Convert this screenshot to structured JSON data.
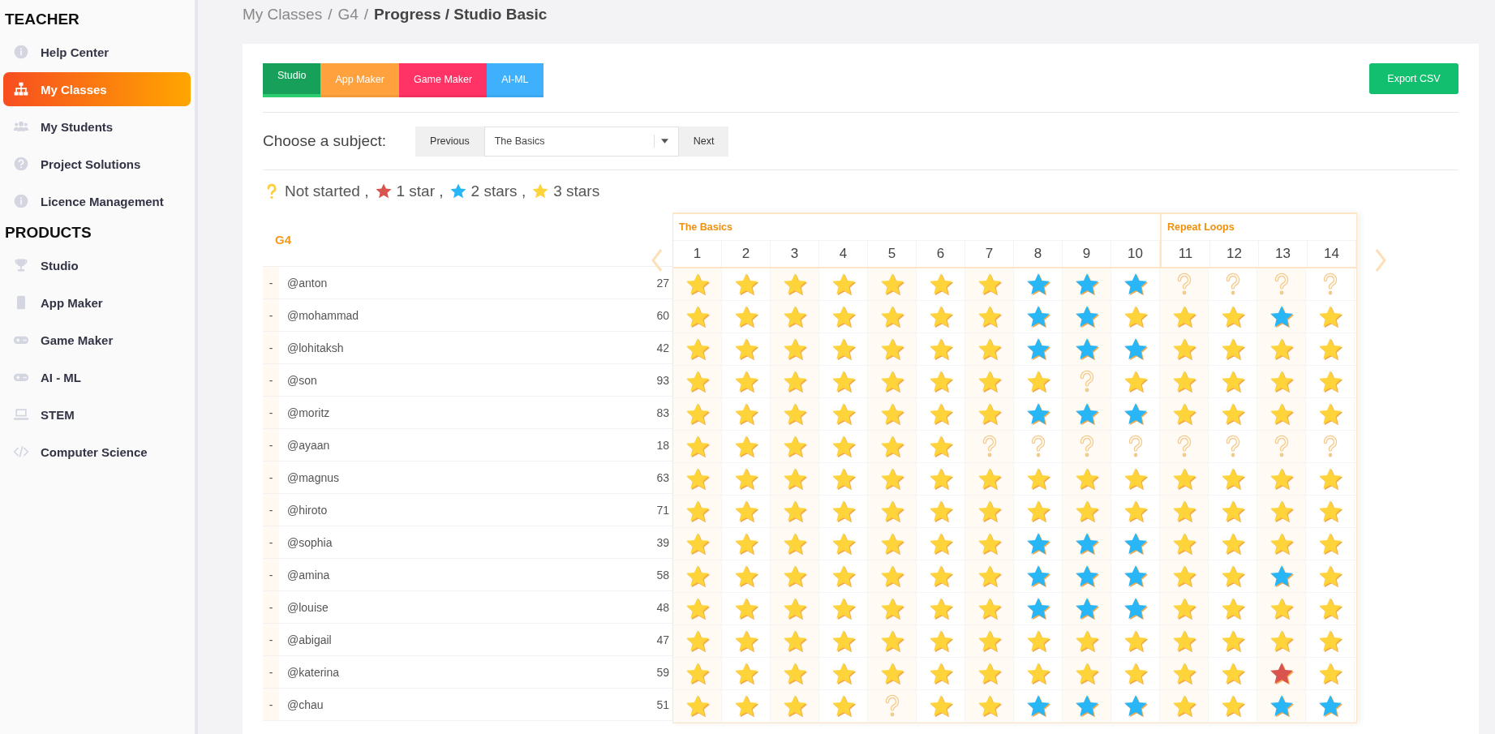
{
  "sidebar": {
    "sections": [
      {
        "heading": "TEACHER",
        "items": [
          {
            "label": "Help Center",
            "selected": false
          },
          {
            "label": "My Classes",
            "selected": true
          },
          {
            "label": "My Students",
            "selected": false
          },
          {
            "label": "Project Solutions",
            "selected": false
          },
          {
            "label": "Licence Management",
            "selected": false
          }
        ]
      },
      {
        "heading": "PRODUCTS",
        "items": [
          {
            "label": "Studio",
            "selected": false
          },
          {
            "label": "App Maker",
            "selected": false
          },
          {
            "label": "Game Maker",
            "selected": false
          },
          {
            "label": "AI - ML",
            "selected": false
          },
          {
            "label": "STEM",
            "selected": false
          },
          {
            "label": "Computer Science",
            "selected": false
          }
        ]
      }
    ]
  },
  "breadcrumb": [
    {
      "kind": "link",
      "text": "My Classes"
    },
    {
      "kind": "sep",
      "text": "/"
    },
    {
      "kind": "link",
      "text": "G4"
    },
    {
      "kind": "sep",
      "text": "/"
    },
    {
      "kind": "current",
      "text": "Progress / Studio Basic"
    }
  ],
  "product_tabs": [
    {
      "label": "Studio",
      "color": "#17a05a",
      "selected": true
    },
    {
      "label": "App Maker",
      "color": "#ffa23e",
      "selected": false
    },
    {
      "label": "Game Maker",
      "color": "#ff3366",
      "selected": false
    },
    {
      "label": "AI-ML",
      "color": "#3fb1fc",
      "selected": false
    }
  ],
  "export_button": "Export CSV",
  "subject": {
    "label": "Choose a subject:",
    "previous": "Previous",
    "value": "The Basics",
    "next": "Next"
  },
  "legend": [
    {
      "kind": "none",
      "label": "Not started ,"
    },
    {
      "kind": "one",
      "label": "1 star ,"
    },
    {
      "kind": "two",
      "label": "2 stars ,"
    },
    {
      "kind": "three",
      "label": "3 stars"
    }
  ],
  "progress_table": {
    "class_name": "G4",
    "sections": [
      {
        "title": "The Basics",
        "columns": [
          "1",
          "2",
          "3",
          "4",
          "5",
          "6",
          "7",
          "8",
          "9",
          "10"
        ]
      },
      {
        "title": "Repeat Loops",
        "columns": [
          "11",
          "12",
          "13",
          "14"
        ]
      }
    ],
    "students": [
      {
        "marker": "-",
        "name": "@anton",
        "score": "27",
        "cells": [
          {
            "kind": "three"
          },
          {
            "kind": "three"
          },
          {
            "kind": "three"
          },
          {
            "kind": "three"
          },
          {
            "kind": "three"
          },
          {
            "kind": "three"
          },
          {
            "kind": "three"
          },
          {
            "kind": "two"
          },
          {
            "kind": "two"
          },
          {
            "kind": "two"
          },
          {
            "kind": "none"
          },
          {
            "kind": "none"
          },
          {
            "kind": "none"
          },
          {
            "kind": "none"
          }
        ]
      },
      {
        "marker": "-",
        "name": "@mohammad",
        "score": "60",
        "cells": [
          {
            "kind": "three"
          },
          {
            "kind": "three"
          },
          {
            "kind": "three"
          },
          {
            "kind": "three"
          },
          {
            "kind": "three"
          },
          {
            "kind": "three"
          },
          {
            "kind": "three"
          },
          {
            "kind": "two"
          },
          {
            "kind": "two"
          },
          {
            "kind": "three"
          },
          {
            "kind": "three"
          },
          {
            "kind": "three"
          },
          {
            "kind": "two"
          },
          {
            "kind": "three"
          }
        ]
      },
      {
        "marker": "-",
        "name": "@lohitaksh",
        "score": "42",
        "cells": [
          {
            "kind": "three"
          },
          {
            "kind": "three"
          },
          {
            "kind": "three"
          },
          {
            "kind": "three"
          },
          {
            "kind": "three"
          },
          {
            "kind": "three"
          },
          {
            "kind": "three"
          },
          {
            "kind": "two"
          },
          {
            "kind": "two"
          },
          {
            "kind": "two"
          },
          {
            "kind": "three"
          },
          {
            "kind": "three"
          },
          {
            "kind": "three"
          },
          {
            "kind": "three"
          }
        ]
      },
      {
        "marker": "-",
        "name": "@son",
        "score": "93",
        "cells": [
          {
            "kind": "three"
          },
          {
            "kind": "three"
          },
          {
            "kind": "three"
          },
          {
            "kind": "three"
          },
          {
            "kind": "three"
          },
          {
            "kind": "three"
          },
          {
            "kind": "three"
          },
          {
            "kind": "three"
          },
          {
            "kind": "none"
          },
          {
            "kind": "three"
          },
          {
            "kind": "three"
          },
          {
            "kind": "three"
          },
          {
            "kind": "three"
          },
          {
            "kind": "three"
          }
        ]
      },
      {
        "marker": "-",
        "name": "@moritz",
        "score": "83",
        "cells": [
          {
            "kind": "three"
          },
          {
            "kind": "three"
          },
          {
            "kind": "three"
          },
          {
            "kind": "three"
          },
          {
            "kind": "three"
          },
          {
            "kind": "three"
          },
          {
            "kind": "three"
          },
          {
            "kind": "two"
          },
          {
            "kind": "two"
          },
          {
            "kind": "two"
          },
          {
            "kind": "three"
          },
          {
            "kind": "three"
          },
          {
            "kind": "three"
          },
          {
            "kind": "three"
          }
        ]
      },
      {
        "marker": "-",
        "name": "@ayaan",
        "score": "18",
        "cells": [
          {
            "kind": "three"
          },
          {
            "kind": "three"
          },
          {
            "kind": "three"
          },
          {
            "kind": "three"
          },
          {
            "kind": "three"
          },
          {
            "kind": "three"
          },
          {
            "kind": "none"
          },
          {
            "kind": "none"
          },
          {
            "kind": "none"
          },
          {
            "kind": "none"
          },
          {
            "kind": "none"
          },
          {
            "kind": "none"
          },
          {
            "kind": "none"
          },
          {
            "kind": "none"
          }
        ]
      },
      {
        "marker": "-",
        "name": "@magnus",
        "score": "63",
        "cells": [
          {
            "kind": "three"
          },
          {
            "kind": "three"
          },
          {
            "kind": "three"
          },
          {
            "kind": "three"
          },
          {
            "kind": "three"
          },
          {
            "kind": "three"
          },
          {
            "kind": "three"
          },
          {
            "kind": "three"
          },
          {
            "kind": "three"
          },
          {
            "kind": "three"
          },
          {
            "kind": "three"
          },
          {
            "kind": "three"
          },
          {
            "kind": "three"
          },
          {
            "kind": "three"
          }
        ]
      },
      {
        "marker": "-",
        "name": "@hiroto",
        "score": "71",
        "cells": [
          {
            "kind": "three"
          },
          {
            "kind": "three"
          },
          {
            "kind": "three"
          },
          {
            "kind": "three"
          },
          {
            "kind": "three"
          },
          {
            "kind": "three"
          },
          {
            "kind": "three"
          },
          {
            "kind": "three"
          },
          {
            "kind": "three"
          },
          {
            "kind": "three"
          },
          {
            "kind": "three"
          },
          {
            "kind": "three"
          },
          {
            "kind": "three"
          },
          {
            "kind": "three"
          }
        ]
      },
      {
        "marker": "-",
        "name": "@sophia",
        "score": "39",
        "cells": [
          {
            "kind": "three"
          },
          {
            "kind": "three"
          },
          {
            "kind": "three"
          },
          {
            "kind": "three"
          },
          {
            "kind": "three"
          },
          {
            "kind": "three"
          },
          {
            "kind": "three"
          },
          {
            "kind": "two"
          },
          {
            "kind": "two"
          },
          {
            "kind": "two"
          },
          {
            "kind": "three"
          },
          {
            "kind": "three"
          },
          {
            "kind": "three"
          },
          {
            "kind": "three"
          }
        ]
      },
      {
        "marker": "-",
        "name": "@amina",
        "score": "58",
        "cells": [
          {
            "kind": "three"
          },
          {
            "kind": "three"
          },
          {
            "kind": "three"
          },
          {
            "kind": "three"
          },
          {
            "kind": "three"
          },
          {
            "kind": "three"
          },
          {
            "kind": "three"
          },
          {
            "kind": "two"
          },
          {
            "kind": "two"
          },
          {
            "kind": "two"
          },
          {
            "kind": "three"
          },
          {
            "kind": "three"
          },
          {
            "kind": "two"
          },
          {
            "kind": "three"
          }
        ]
      },
      {
        "marker": "-",
        "name": "@louise",
        "score": "48",
        "cells": [
          {
            "kind": "three"
          },
          {
            "kind": "three"
          },
          {
            "kind": "three"
          },
          {
            "kind": "three"
          },
          {
            "kind": "three"
          },
          {
            "kind": "three"
          },
          {
            "kind": "three"
          },
          {
            "kind": "two"
          },
          {
            "kind": "two"
          },
          {
            "kind": "two"
          },
          {
            "kind": "three"
          },
          {
            "kind": "three"
          },
          {
            "kind": "three"
          },
          {
            "kind": "three"
          }
        ]
      },
      {
        "marker": "-",
        "name": "@abigail",
        "score": "47",
        "cells": [
          {
            "kind": "three"
          },
          {
            "kind": "three"
          },
          {
            "kind": "three"
          },
          {
            "kind": "three"
          },
          {
            "kind": "three"
          },
          {
            "kind": "three"
          },
          {
            "kind": "three"
          },
          {
            "kind": "three"
          },
          {
            "kind": "three"
          },
          {
            "kind": "three"
          },
          {
            "kind": "three"
          },
          {
            "kind": "three"
          },
          {
            "kind": "three"
          },
          {
            "kind": "three"
          }
        ]
      },
      {
        "marker": "-",
        "name": "@katerina",
        "score": "59",
        "cells": [
          {
            "kind": "three"
          },
          {
            "kind": "three"
          },
          {
            "kind": "three"
          },
          {
            "kind": "three"
          },
          {
            "kind": "three"
          },
          {
            "kind": "three"
          },
          {
            "kind": "three"
          },
          {
            "kind": "three"
          },
          {
            "kind": "three"
          },
          {
            "kind": "three"
          },
          {
            "kind": "three"
          },
          {
            "kind": "three"
          },
          {
            "kind": "one"
          },
          {
            "kind": "three"
          }
        ]
      },
      {
        "marker": "-",
        "name": "@chau",
        "score": "51",
        "cells": [
          {
            "kind": "three"
          },
          {
            "kind": "three"
          },
          {
            "kind": "three"
          },
          {
            "kind": "three"
          },
          {
            "kind": "none"
          },
          {
            "kind": "three"
          },
          {
            "kind": "three"
          },
          {
            "kind": "two"
          },
          {
            "kind": "two"
          },
          {
            "kind": "two"
          },
          {
            "kind": "three"
          },
          {
            "kind": "three"
          },
          {
            "kind": "two"
          },
          {
            "kind": "two"
          }
        ]
      }
    ]
  }
}
